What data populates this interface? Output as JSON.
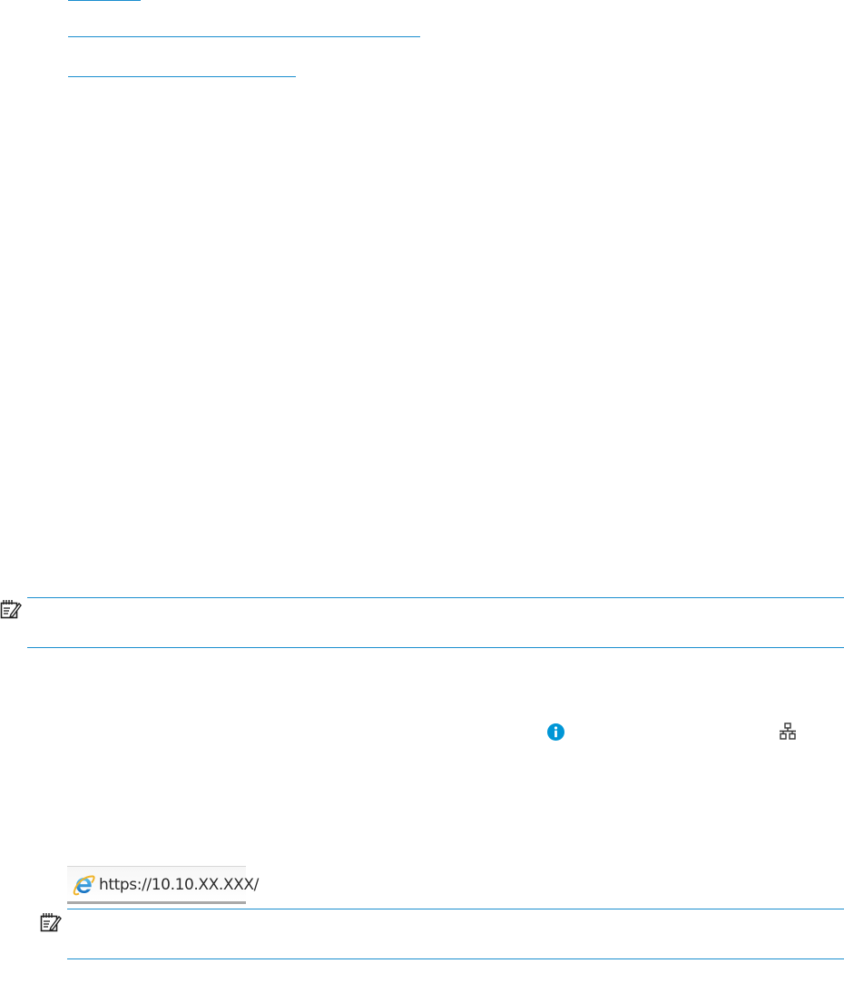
{
  "top_links": [
    {
      "name": "link-1",
      "text": ""
    },
    {
      "name": "link-2",
      "text": ""
    },
    {
      "name": "link-3",
      "text": ""
    }
  ],
  "icons": {
    "note_1": "note-icon",
    "note_2": "note-icon",
    "info": "info-icon",
    "network": "network-icon",
    "browser": "internet-explorer-icon"
  },
  "address_bar": {
    "url": "https://10.10.XX.XXX/"
  },
  "colors": {
    "rule": "#1a8ecf",
    "link": "#1a8ecf",
    "info_icon": "#0096d6",
    "text": "#2c2c2c"
  }
}
